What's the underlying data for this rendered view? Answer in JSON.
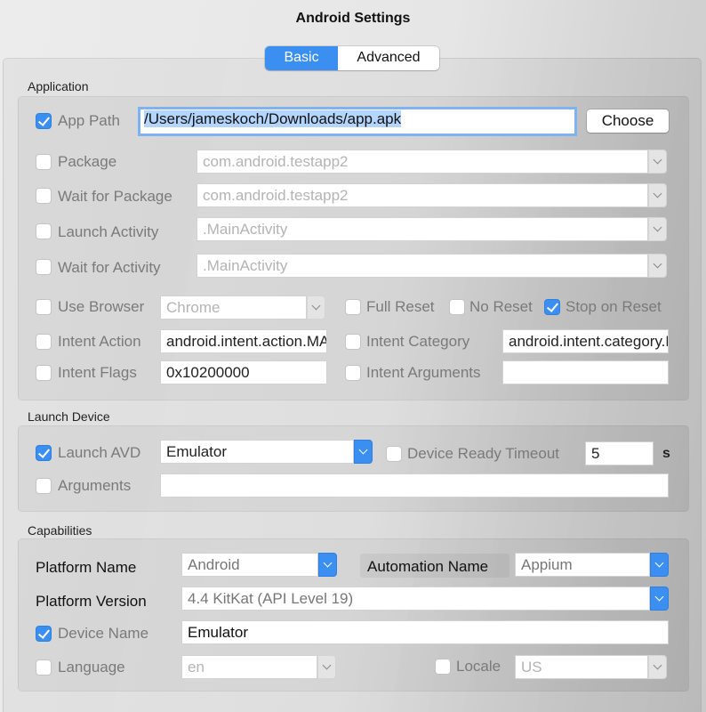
{
  "window": {
    "title": "Android Settings"
  },
  "tabs": [
    {
      "label": "Basic",
      "active": true
    },
    {
      "label": "Advanced",
      "active": false
    }
  ],
  "colors": {
    "accent": "#3b8ff0",
    "selection": "#b4d5fe",
    "focus_ring": "#7fb2ee"
  },
  "application": {
    "section_label": "Application",
    "app_path": {
      "label": "App Path",
      "checked": true,
      "value": "/Users/jameskoch/Downloads/app.apk",
      "button": "Choose"
    },
    "package": {
      "label": "Package",
      "checked": false,
      "value": "com.android.testapp2"
    },
    "wait_for_package": {
      "label": "Wait for Package",
      "checked": false,
      "value": "com.android.testapp2"
    },
    "launch_activity": {
      "label": "Launch Activity",
      "checked": false,
      "value": ".MainActivity"
    },
    "wait_for_activity": {
      "label": "Wait for Activity",
      "checked": false,
      "value": ".MainActivity"
    },
    "use_browser": {
      "label": "Use Browser",
      "checked": false,
      "value": "Chrome"
    },
    "full_reset": {
      "label": "Full Reset",
      "checked": false
    },
    "no_reset": {
      "label": "No Reset",
      "checked": false
    },
    "stop_on_reset": {
      "label": "Stop on Reset",
      "checked": true
    },
    "intent_action": {
      "label": "Intent Action",
      "checked": false,
      "value": "android.intent.action.MAIN"
    },
    "intent_category": {
      "label": "Intent Category",
      "checked": false,
      "value": "android.intent.category.LAUNCHER"
    },
    "intent_flags": {
      "label": "Intent Flags",
      "checked": false,
      "value": "0x10200000"
    },
    "intent_arguments": {
      "label": "Intent Arguments",
      "checked": false,
      "value": ""
    }
  },
  "launch_device": {
    "section_label": "Launch Device",
    "launch_avd": {
      "label": "Launch AVD",
      "checked": true,
      "value": "Emulator"
    },
    "device_ready_timeout": {
      "label": "Device Ready Timeout",
      "checked": false,
      "value": "5",
      "unit": "s"
    },
    "arguments": {
      "label": "Arguments",
      "checked": false,
      "value": ""
    }
  },
  "capabilities": {
    "section_label": "Capabilities",
    "platform_name": {
      "label": "Platform Name",
      "value": "Android"
    },
    "automation_name": {
      "label": "Automation Name",
      "value": "Appium"
    },
    "platform_version": {
      "label": "Platform Version",
      "value": "4.4 KitKat (API Level 19)"
    },
    "device_name": {
      "label": "Device Name",
      "checked": true,
      "value": "Emulator"
    },
    "language": {
      "label": "Language",
      "checked": false,
      "value": "en"
    },
    "locale": {
      "label": "Locale",
      "checked": false,
      "value": "US"
    }
  }
}
